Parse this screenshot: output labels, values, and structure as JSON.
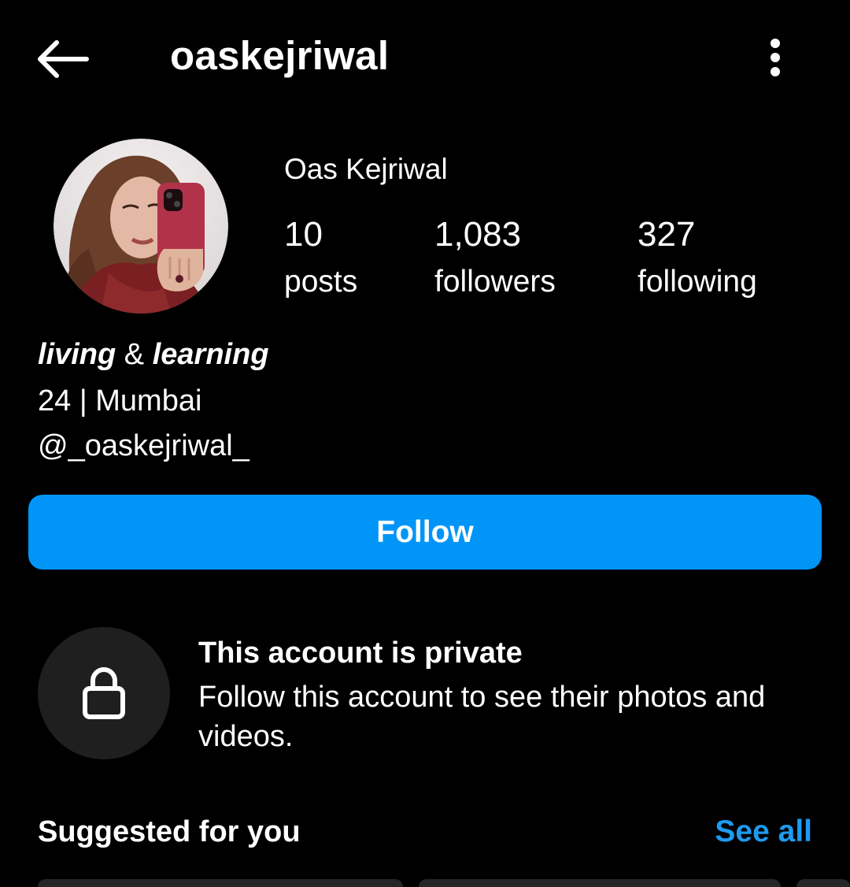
{
  "header": {
    "back_icon": "arrow-left-icon",
    "username": "oaskejriwal",
    "menu_icon": "more-vertical-icon"
  },
  "profile": {
    "display_name": "Oas Kejriwal",
    "stats": [
      {
        "count": "10",
        "label": "posts"
      },
      {
        "count": "1,083",
        "label": "followers"
      },
      {
        "count": "327",
        "label": "following"
      }
    ],
    "bio": {
      "headline_part1": "living",
      "headline_amp": "&",
      "headline_part2": "learning",
      "line1": "24 | Mumbai",
      "line2": "@_oaskejriwal_"
    }
  },
  "actions": {
    "follow_label": "Follow"
  },
  "private_notice": {
    "icon": "lock-icon",
    "title": "This account is private",
    "body": "Follow this account to see their photos and videos."
  },
  "suggested": {
    "title": "Suggested for you",
    "see_all_label": "See all"
  },
  "colors": {
    "background": "#000000",
    "accent": "#0095f6",
    "link": "#1d9bf0",
    "lock_circle": "#1f1f1f"
  }
}
